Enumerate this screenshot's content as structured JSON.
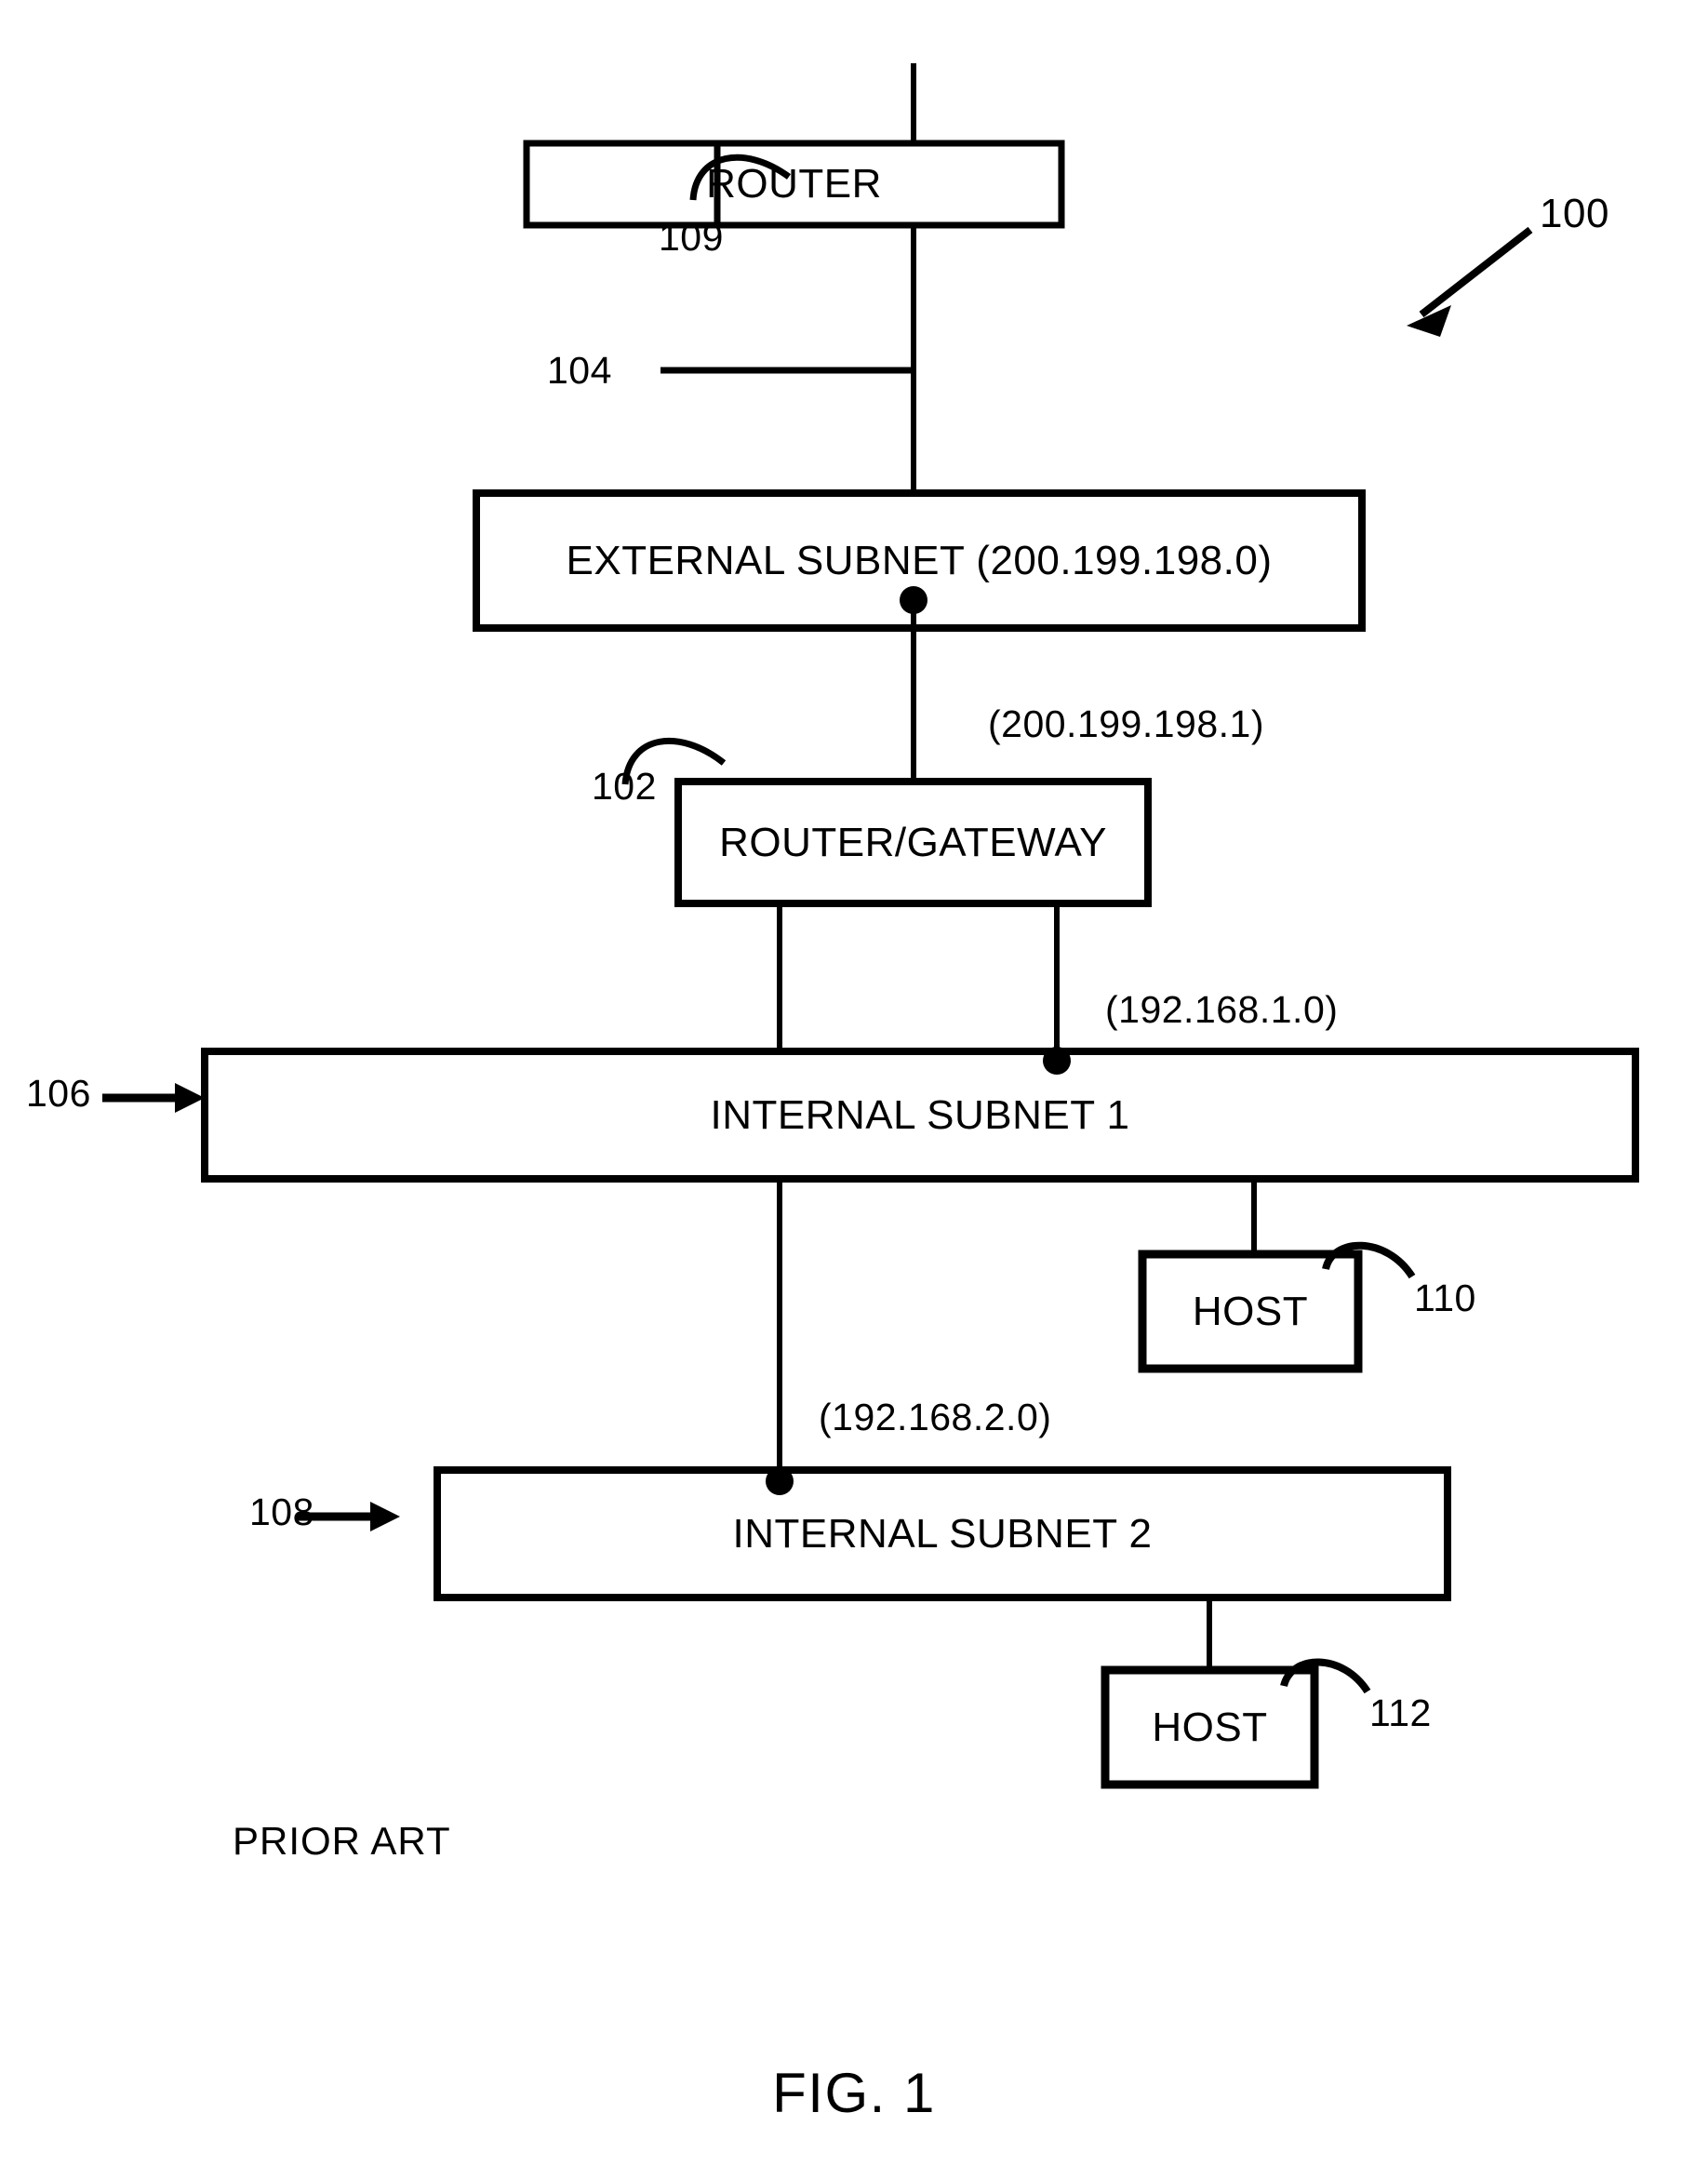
{
  "figure": {
    "number_label": "100",
    "prior_art_note": "PRIOR ART",
    "title": "FIG. 1"
  },
  "nodes": {
    "router": {
      "label": "ROUTER",
      "ref": "109"
    },
    "external_subnet": {
      "label": "EXTERNAL SUBNET (200.199.198.0)",
      "network": "200.199.198.0"
    },
    "router_gateway": {
      "label": "ROUTER/GATEWAY",
      "ref": "102",
      "external_ip": "(200.199.198.1)"
    },
    "internal_subnet_1": {
      "label": "INTERNAL SUBNET 1",
      "ref": "106",
      "network": "(192.168.1.0)"
    },
    "internal_subnet_2": {
      "label": "INTERNAL SUBNET 2",
      "ref": "108",
      "network": "(192.168.2.0)"
    },
    "host_1": {
      "label": "HOST",
      "ref": "110"
    },
    "host_2": {
      "label": "HOST",
      "ref": "112"
    }
  },
  "links": {
    "uplink_ref": "104"
  },
  "colors": {
    "stroke": "#000000",
    "background": "#ffffff"
  }
}
